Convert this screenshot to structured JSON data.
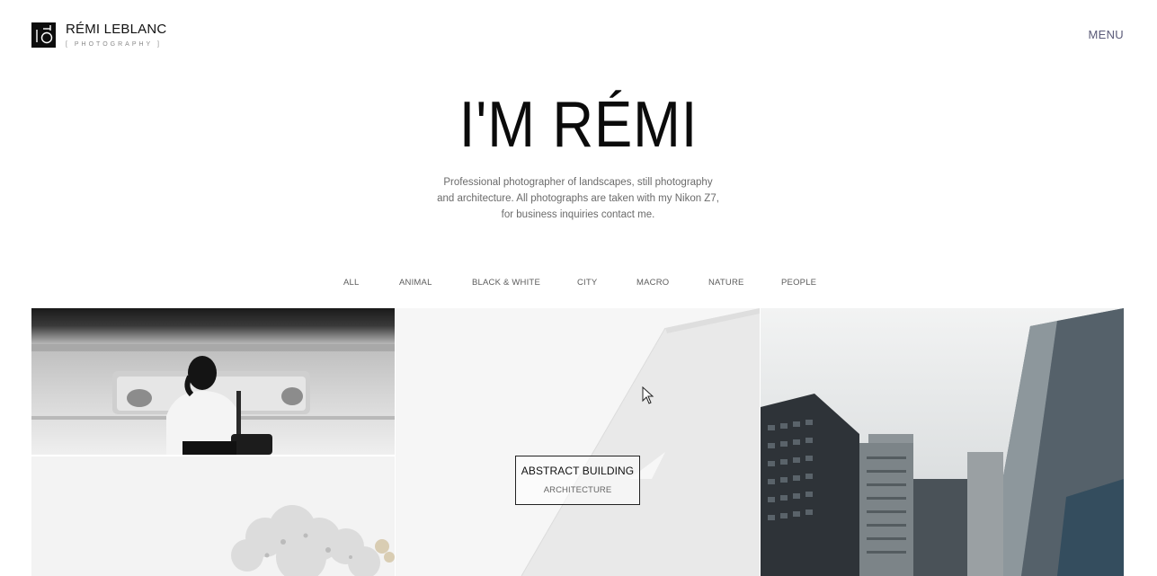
{
  "header": {
    "logo_name": "RÉMI LEBLANC",
    "logo_sub": "[ PHOTOGRAPHY ]",
    "menu_label": "MENU"
  },
  "hero": {
    "title": "I'M RÉMI",
    "description": "Professional photographer of landscapes, still photography and architecture. All photographs are taken with my Nikon Z7, for business inquiries contact me."
  },
  "filters": [
    "ALL",
    "ANIMAL",
    "BLACK & WHITE",
    "CITY",
    "MACRO",
    "NATURE",
    "PEOPLE"
  ],
  "gallery": {
    "hovered_caption": {
      "title": "ABSTRACT BUILDING",
      "category": "ARCHITECTURE"
    }
  },
  "colors": {
    "accent": "#5a5a78",
    "text": "#111111",
    "muted": "#6b6b6b"
  }
}
